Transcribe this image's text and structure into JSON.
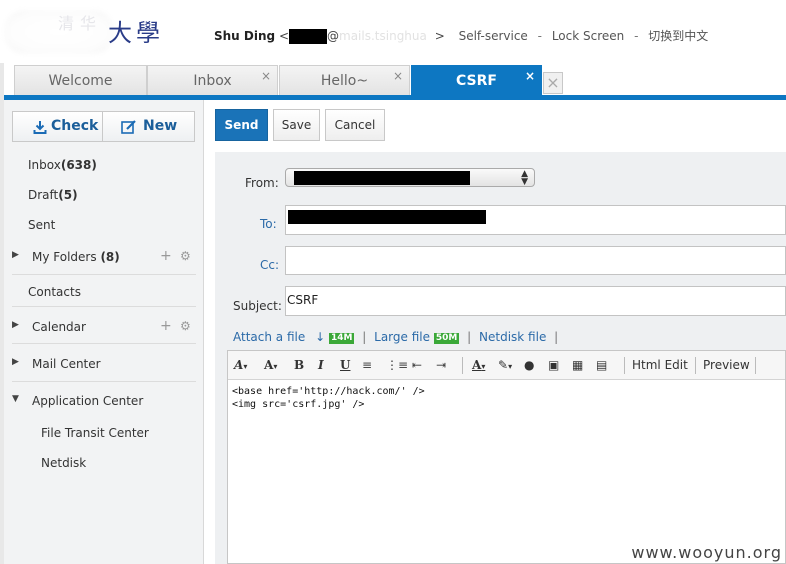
{
  "header": {
    "logo_chars": "大學",
    "logo_faint_chars": "清华",
    "user_name": "Shu Ding",
    "email_open": "<",
    "email_mid": "@",
    "email_faint": "mails.tsinghua",
    "email_close": ">",
    "links": [
      "Self-service",
      "Lock Screen",
      "切换到中文"
    ],
    "sep": "-"
  },
  "tabs": [
    {
      "label": "Welcome",
      "closable": false
    },
    {
      "label": "Inbox",
      "closable": true
    },
    {
      "label": "Hello~",
      "closable": true
    },
    {
      "label": "CSRF",
      "closable": true,
      "active": true
    }
  ],
  "tab_close_glyph": "×",
  "sidebar": {
    "check_label": "Check",
    "new_label": "New",
    "inbox": "Inbox",
    "inbox_count": "(638)",
    "draft": "Draft",
    "draft_count": "(5)",
    "sent": "Sent",
    "my_folders": "My Folders",
    "my_folders_count": "(8)",
    "contacts": "Contacts",
    "calendar": "Calendar",
    "mail_center": "Mail Center",
    "app_center": "Application Center",
    "file_transit": "File Transit Center",
    "netdisk": "Netdisk"
  },
  "toolbar": {
    "send": "Send",
    "save": "Save",
    "cancel": "Cancel"
  },
  "compose": {
    "from_label": "From:",
    "to_label": "To:",
    "cc_label": "Cc:",
    "subject_label": "Subject:",
    "subject_value": "CSRF",
    "attach_file": "Attach a file",
    "attach_limit": "14M",
    "large_file": "Large file",
    "large_limit": "50M",
    "netdisk_file": "Netdisk file",
    "pipe": "|"
  },
  "editor": {
    "html_edit": "Html Edit",
    "preview": "Preview",
    "content": "<base href='http://hack.com/' />\n<img src='csrf.jpg' />"
  },
  "watermark": "www.wooyun.org",
  "colors": {
    "accent": "#0d77c2",
    "send_button": "#1a73b8",
    "link": "#2b6aa8",
    "badge": "#3aa838"
  }
}
